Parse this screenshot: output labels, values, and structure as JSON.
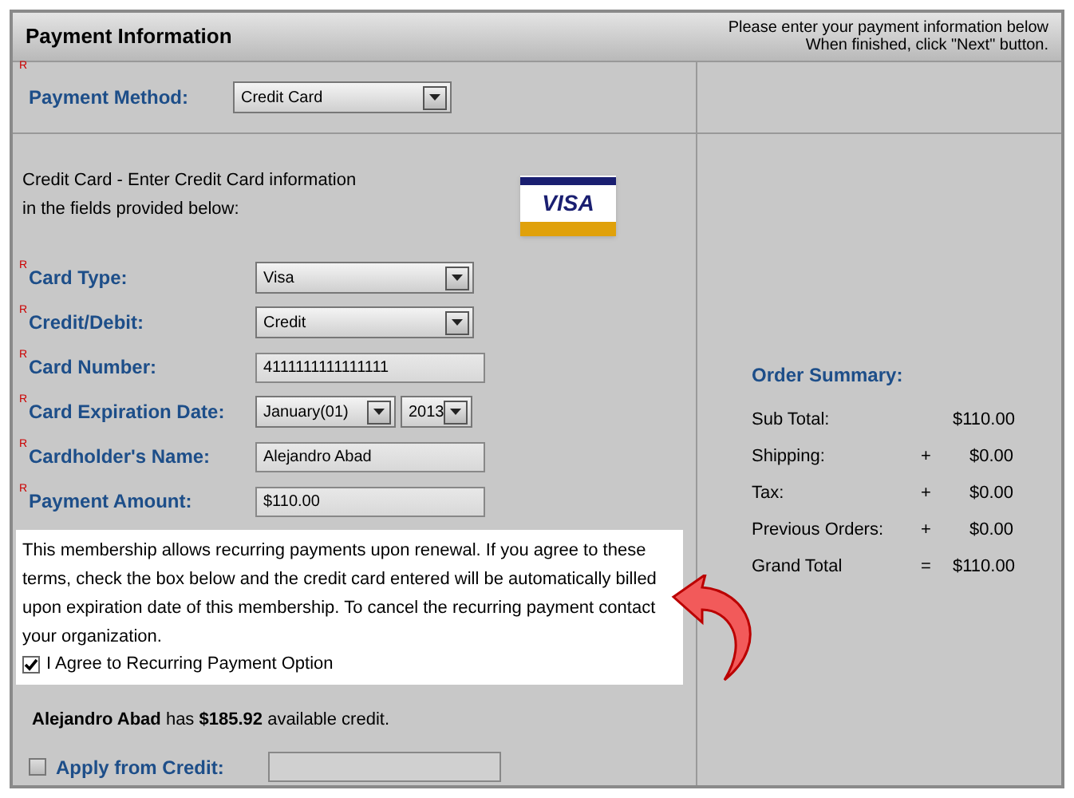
{
  "header": {
    "title": "Payment Information",
    "instructions": [
      "Please enter your payment information below",
      "When finished, click \"Next\" button."
    ]
  },
  "payment_method": {
    "label": "Payment Method:",
    "required_mark": "R",
    "value": "Credit Card"
  },
  "intro": [
    "Credit Card - Enter Credit Card information",
    "in the fields provided below:"
  ],
  "card_logo": {
    "text": "VISA"
  },
  "fields": [
    {
      "label": "Card Type:",
      "required_mark": "R",
      "kind": "select",
      "values": [
        "Visa"
      ]
    },
    {
      "label": "Credit/Debit:",
      "required_mark": "R",
      "kind": "select",
      "values": [
        "Credit"
      ]
    },
    {
      "label": "Card Number:",
      "required_mark": "R",
      "kind": "text",
      "values": [
        "4111111111111111"
      ]
    },
    {
      "label": "Card Expiration Date:",
      "required_mark": "R",
      "kind": "date",
      "values": [
        "January(01)",
        "2013"
      ]
    },
    {
      "label": "Cardholder's Name:",
      "required_mark": "R",
      "kind": "text",
      "values": [
        "Alejandro Abad"
      ]
    },
    {
      "label": "Payment Amount:",
      "required_mark": "R",
      "kind": "text",
      "values": [
        "$110.00"
      ]
    }
  ],
  "notice": {
    "text": "This membership allows recurring payments upon renewal. If you agree to these terms, check the box below and the credit card entered will be automatically billed upon expiration date of this membership. To cancel the recurring payment contact your organization.",
    "agree": {
      "label": "I Agree to Recurring Payment Option",
      "checked": true
    }
  },
  "credit_note": "**Alejandro Abad** has **$185.92** available credit.",
  "apply_credit": {
    "label": "Apply from Credit:",
    "checked": false
  },
  "order_summary": {
    "title": "Order Summary:",
    "rows": [
      {
        "label": "Sub Total:",
        "operator": "",
        "amount": "$110.00"
      },
      {
        "label": "Shipping:",
        "operator": "+",
        "amount": "$0.00"
      },
      {
        "label": "Tax:",
        "operator": "+",
        "amount": "$0.00"
      },
      {
        "label": "Previous Orders:",
        "operator": "+",
        "amount": "$0.00"
      },
      {
        "label": "Grand Total",
        "operator": "=",
        "amount": "$110.00"
      }
    ]
  }
}
